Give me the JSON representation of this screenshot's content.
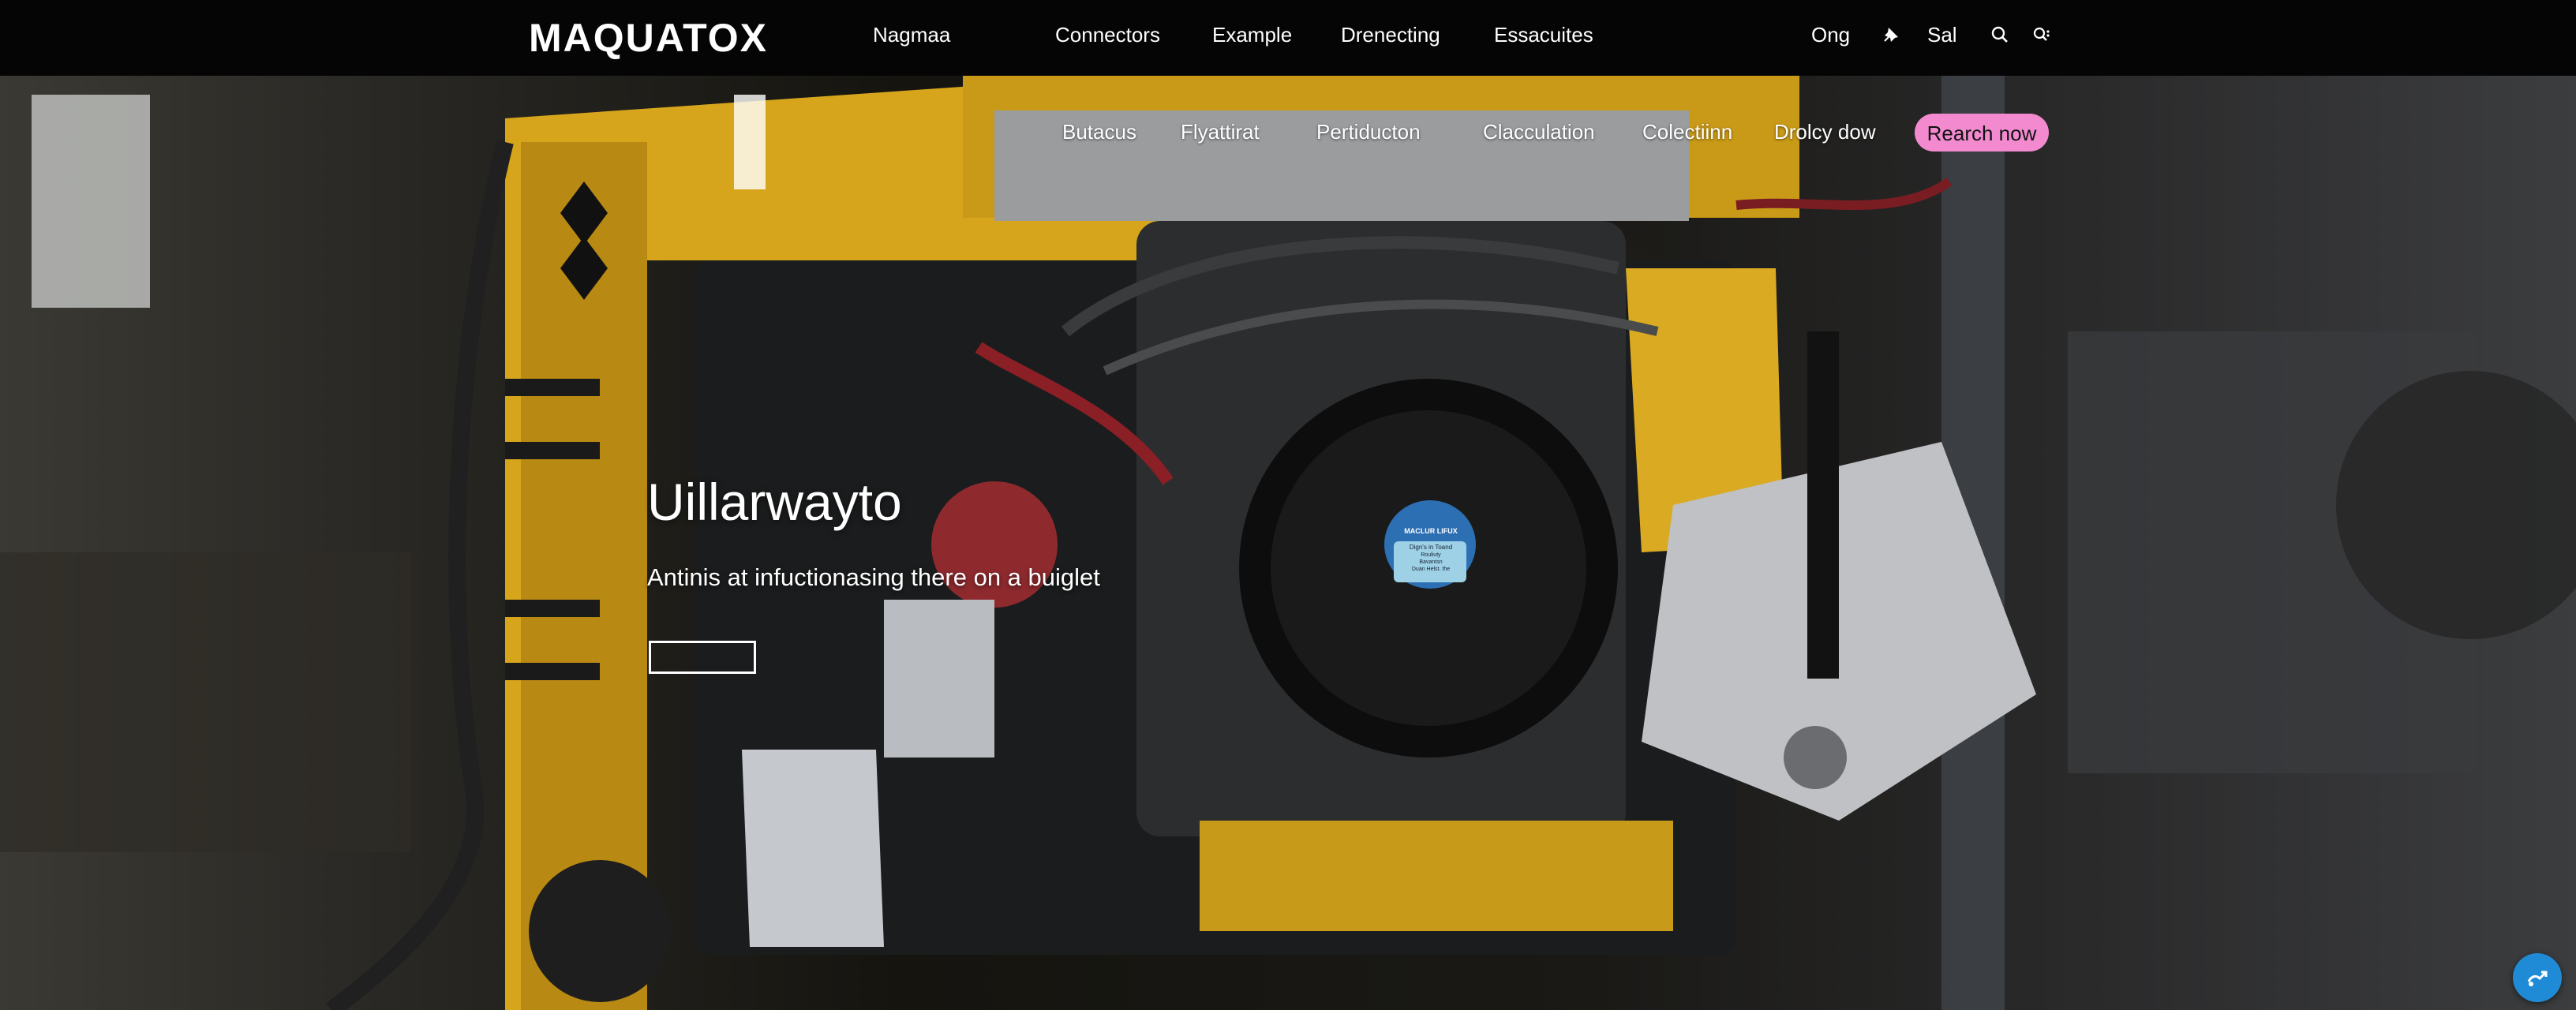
{
  "brand": {
    "logo_text": "MAQUATOX"
  },
  "top_nav": {
    "links": [
      "Nagmaa",
      "Connectors",
      "Example",
      "Drenecting",
      "Essacuites"
    ],
    "right_text": [
      "Ong",
      "Sal"
    ],
    "icons": [
      "pin-icon",
      "search-icon",
      "search-settings-icon"
    ]
  },
  "sub_nav": {
    "links": [
      "Butacus",
      "Flyattirat",
      "Pertiducton",
      "Clacculation",
      "Colectiinn",
      "Drolcy dow"
    ],
    "cta_label": "Rearch now"
  },
  "hero": {
    "title": "Uillarwayto",
    "subtitle": "Antinis at infuctionasing there on a buiglet",
    "button_label": ""
  },
  "machine_plate": {
    "lines": [
      "MACLUR LIFUX",
      "Dign's in Toand",
      "Rouliuty",
      "Bavantsn",
      "Duan Helst. the"
    ]
  },
  "fab": {
    "icon": "chat-icon"
  },
  "colors": {
    "accent_pink": "#f38ad0",
    "machine_yellow": "#d6a51c",
    "fab_blue": "#1f8bd6",
    "nav_bg": "#050505"
  }
}
